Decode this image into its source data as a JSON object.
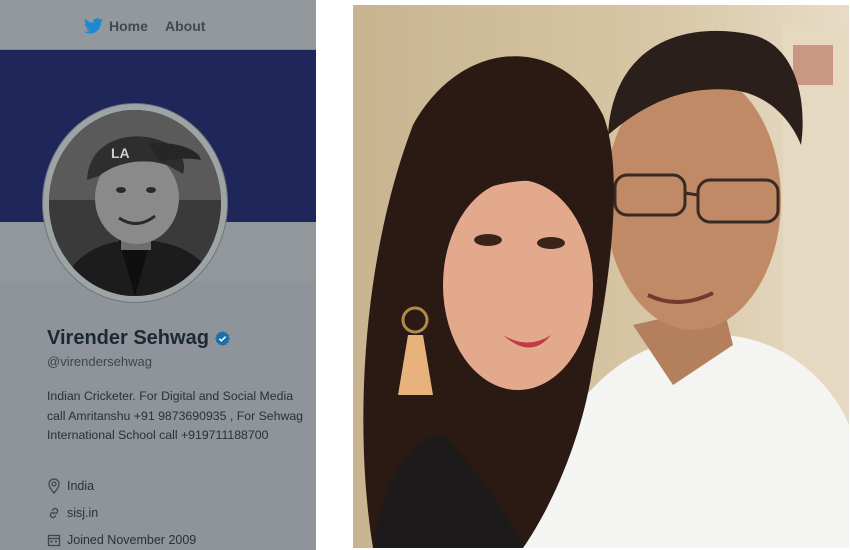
{
  "nav": {
    "home_label": "Home",
    "about_label": "About"
  },
  "profile": {
    "name": "Virender Sehwag",
    "handle": "@virendersehwag",
    "bio": "Indian Cricketer. For Digital and Social Media call Amritanshu +91 9873690935 , For Sehwag International School call +919711188700",
    "location": "India",
    "website": "sisj.in",
    "joined": "Joined November 2009"
  },
  "colors": {
    "banner": "#1f265a",
    "verified": "#1da1f2",
    "twitter_blue": "#1b8ad0"
  },
  "icons": [
    "twitter-bird-icon",
    "verified-badge-icon",
    "location-pin-icon",
    "link-icon",
    "calendar-icon"
  ]
}
